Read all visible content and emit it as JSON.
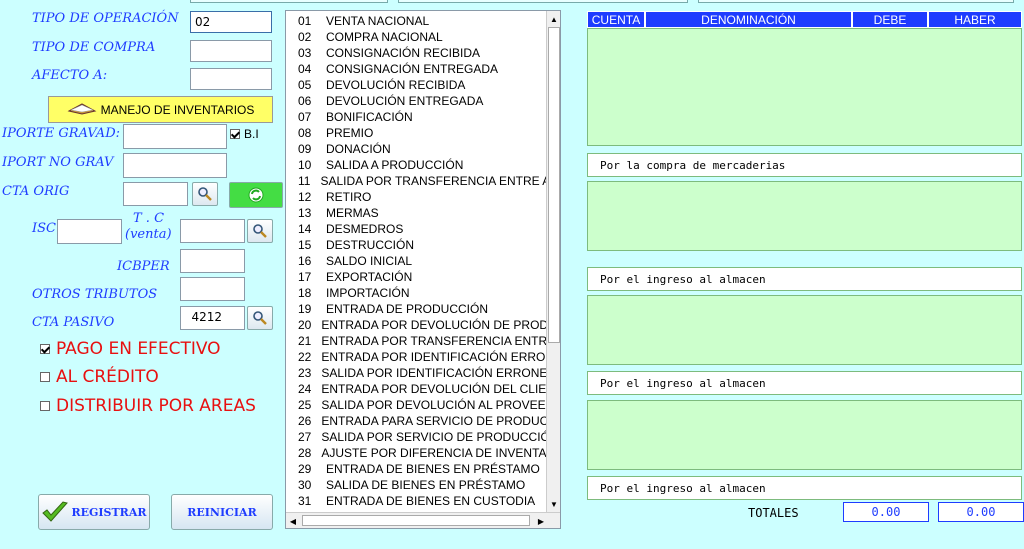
{
  "form": {
    "tipo_operacion_label": "TIPO DE OPERACIÓN",
    "tipo_operacion_value": "02",
    "tipo_compra_label": "TIPO DE COMPRA",
    "tipo_compra_value": "",
    "afecto_label": "AFECTO A:",
    "afecto_value": "",
    "manejo_inventarios_label": "MANEJO DE INVENTARIOS",
    "importe_gravado_label": "IPORTE GRAVAD:",
    "importe_gravado_value": "",
    "bi_label": "B.I",
    "bi_checked": true,
    "import_no_grav_label": "IPORT NO GRAV",
    "import_no_grav_value": "",
    "cta_orig_label": "CTA ORIG",
    "cta_orig_value": "",
    "isc_label": "ISC",
    "isc_value": "",
    "tc_label_line1": "T . C",
    "tc_label_line2": "(venta)",
    "tc_value": "",
    "icbper_label": "ICBPER",
    "icbper_value": "",
    "otros_tributos_label": "OTROS TRIBUTOS",
    "otros_tributos_value": "",
    "cta_pasivo_label": "CTA PASIVO",
    "cta_pasivo_value": "4212"
  },
  "checkboxes": [
    {
      "label": "PAGO EN EFECTIVO",
      "checked": true
    },
    {
      "label": "AL CRÉDITO",
      "checked": false
    },
    {
      "label": "DISTRIBUIR POR AREAS",
      "checked": false
    }
  ],
  "buttons": {
    "registrar": "REGISTRAR",
    "reiniciar": "REINICIAR"
  },
  "operation_list": [
    {
      "code": "01",
      "label": "VENTA NACIONAL"
    },
    {
      "code": "02",
      "label": "COMPRA NACIONAL"
    },
    {
      "code": "03",
      "label": "CONSIGNACIÓN RECIBIDA"
    },
    {
      "code": "04",
      "label": "CONSIGNACIÓN ENTREGADA"
    },
    {
      "code": "05",
      "label": "DEVOLUCIÓN RECIBIDA"
    },
    {
      "code": "06",
      "label": "DEVOLUCIÓN ENTREGADA"
    },
    {
      "code": "07",
      "label": "BONIFICACIÓN"
    },
    {
      "code": "08",
      "label": "PREMIO"
    },
    {
      "code": "09",
      "label": "DONACIÓN"
    },
    {
      "code": "10",
      "label": "SALIDA A PRODUCCIÓN"
    },
    {
      "code": "11",
      "label": "SALIDA POR TRANSFERENCIA ENTRE Al"
    },
    {
      "code": "12",
      "label": "RETIRO"
    },
    {
      "code": "13",
      "label": "MERMAS"
    },
    {
      "code": "14",
      "label": "DESMEDROS"
    },
    {
      "code": "15",
      "label": "DESTRUCCIÓN"
    },
    {
      "code": "16",
      "label": "SALDO INICIAL"
    },
    {
      "code": "17",
      "label": "EXPORTACIÓN"
    },
    {
      "code": "18",
      "label": "IMPORTACIÓN"
    },
    {
      "code": "19",
      "label": "ENTRADA DE PRODUCCIÓN"
    },
    {
      "code": "20",
      "label": "ENTRADA POR DEVOLUCIÓN DE PRODU"
    },
    {
      "code": "21",
      "label": "ENTRADA POR TRANSFERENCIA ENTRE"
    },
    {
      "code": "22",
      "label": "ENTRADA POR IDENTIFICACIÓN ERRON"
    },
    {
      "code": "23",
      "label": "SALIDA POR IDENTIFICACIÓN ERRONEA"
    },
    {
      "code": "24",
      "label": "ENTRADA POR DEVOLUCIÓN DEL CLIEN"
    },
    {
      "code": "25",
      "label": "SALIDA POR DEVOLUCIÓN AL PROVEED"
    },
    {
      "code": "26",
      "label": "ENTRADA PARA SERVICIO DE PRODUCC"
    },
    {
      "code": "27",
      "label": "SALIDA POR SERVICIO DE PRODUCCIÓ"
    },
    {
      "code": "28",
      "label": "AJUSTE POR DIFERENCIA DE INVENTAR"
    },
    {
      "code": "29",
      "label": "ENTRADA DE BIENES EN PRÉSTAMO"
    },
    {
      "code": "30",
      "label": "SALIDA DE BIENES EN PRÉSTAMO"
    },
    {
      "code": "31",
      "label": "ENTRADA DE BIENES EN CUSTODIA"
    }
  ],
  "table": {
    "headers": [
      "CUENTA",
      "DENOMINACIÓN",
      "DEBE",
      "HABER"
    ]
  },
  "glosas": [
    "Por la compra de mercaderias",
    "Por el ingreso al almacen",
    "Por el ingreso al almacen",
    "Por el ingreso al almacen"
  ],
  "totals": {
    "label": "TOTALES",
    "debe": "0.00",
    "haber": "0.00"
  },
  "colors": {
    "background": "#ccffff",
    "label_blue": "#1e3cff",
    "checkbox_red": "#e81010",
    "grid_green": "#ccffcc",
    "inventory_button": "#ffff66",
    "header_blue": "#1e3cff"
  }
}
